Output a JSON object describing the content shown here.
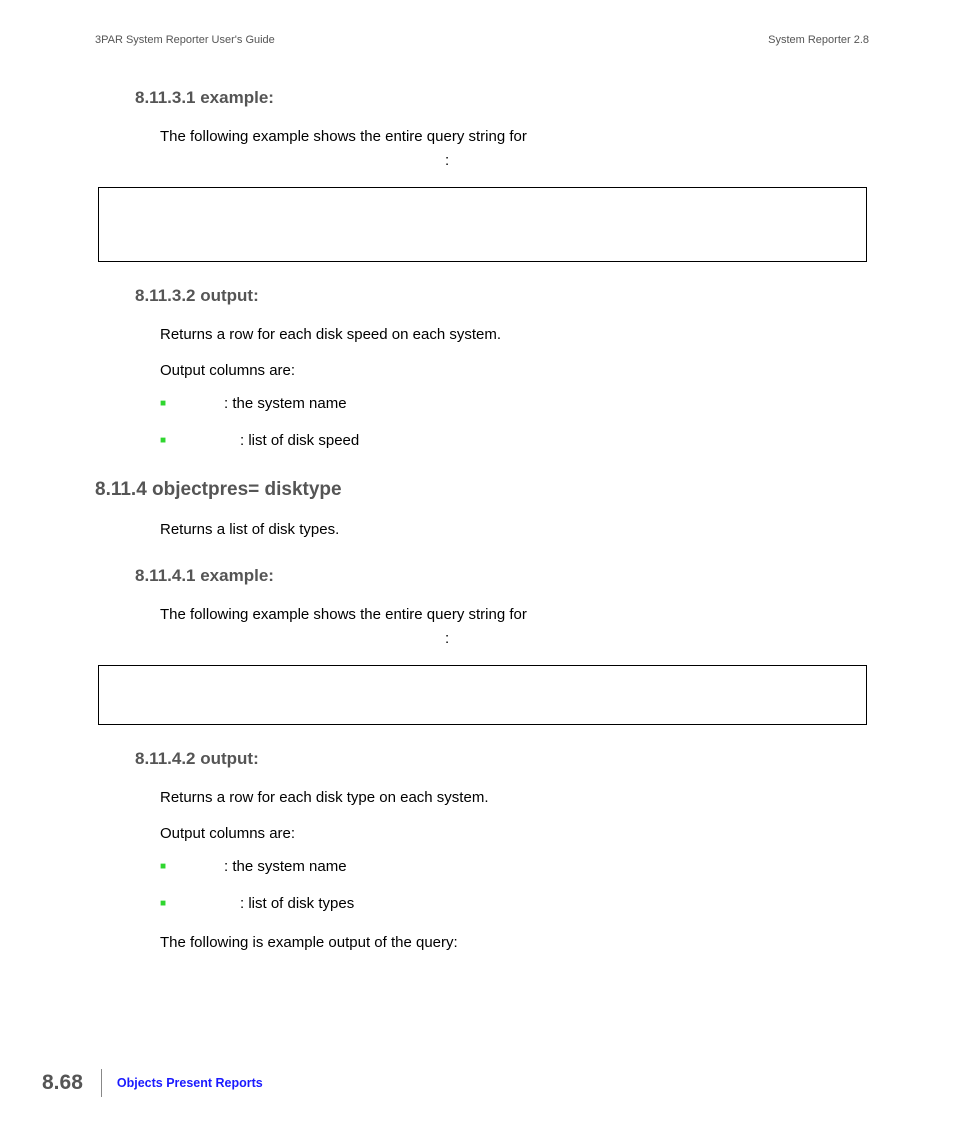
{
  "header": {
    "left": "3PAR System Reporter User's Guide",
    "right": "System Reporter 2.8"
  },
  "sec1": {
    "heading": "8.11.3.1 example:",
    "p1": "The following example shows the entire query string for",
    "colon": ":"
  },
  "sec2": {
    "heading": "8.11.3.2 output:",
    "p1": "Returns a row for each disk speed on each system.",
    "p2": "Output columns are:",
    "b1": ": the system name",
    "b2": ": list of disk speed"
  },
  "sec3": {
    "heading": "8.11.4 objectpres= disktype",
    "p1": "Returns a list of disk types."
  },
  "sec4": {
    "heading": "8.11.4.1 example:",
    "p1": "The following example shows the entire query string for",
    "colon": ":"
  },
  "sec5": {
    "heading": "8.11.4.2 output:",
    "p1": "Returns a row for each disk type on each system.",
    "p2": "Output columns are:",
    "b1": ": the system name",
    "b2": ": list of disk types",
    "p3": "The following is example output of the query:"
  },
  "footer": {
    "page": "8.68",
    "link": "Objects Present Reports"
  }
}
